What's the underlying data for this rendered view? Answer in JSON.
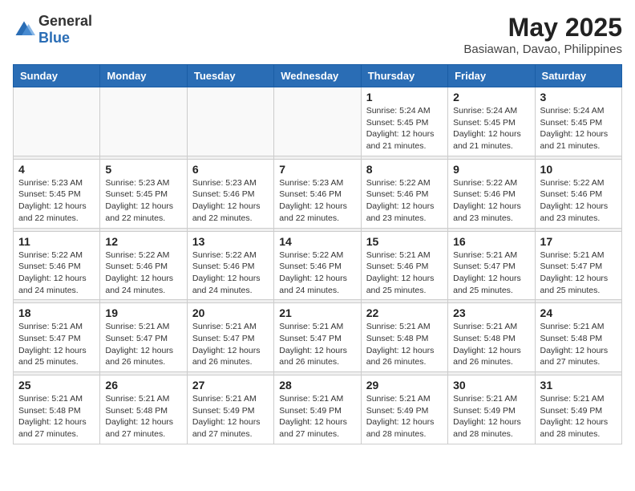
{
  "header": {
    "logo_general": "General",
    "logo_blue": "Blue",
    "title": "May 2025",
    "subtitle": "Basiawan, Davao, Philippines"
  },
  "weekdays": [
    "Sunday",
    "Monday",
    "Tuesday",
    "Wednesday",
    "Thursday",
    "Friday",
    "Saturday"
  ],
  "weeks": [
    [
      {
        "day": "",
        "info": ""
      },
      {
        "day": "",
        "info": ""
      },
      {
        "day": "",
        "info": ""
      },
      {
        "day": "",
        "info": ""
      },
      {
        "day": "1",
        "info": "Sunrise: 5:24 AM\nSunset: 5:45 PM\nDaylight: 12 hours\nand 21 minutes."
      },
      {
        "day": "2",
        "info": "Sunrise: 5:24 AM\nSunset: 5:45 PM\nDaylight: 12 hours\nand 21 minutes."
      },
      {
        "day": "3",
        "info": "Sunrise: 5:24 AM\nSunset: 5:45 PM\nDaylight: 12 hours\nand 21 minutes."
      }
    ],
    [
      {
        "day": "4",
        "info": "Sunrise: 5:23 AM\nSunset: 5:45 PM\nDaylight: 12 hours\nand 22 minutes."
      },
      {
        "day": "5",
        "info": "Sunrise: 5:23 AM\nSunset: 5:45 PM\nDaylight: 12 hours\nand 22 minutes."
      },
      {
        "day": "6",
        "info": "Sunrise: 5:23 AM\nSunset: 5:46 PM\nDaylight: 12 hours\nand 22 minutes."
      },
      {
        "day": "7",
        "info": "Sunrise: 5:23 AM\nSunset: 5:46 PM\nDaylight: 12 hours\nand 22 minutes."
      },
      {
        "day": "8",
        "info": "Sunrise: 5:22 AM\nSunset: 5:46 PM\nDaylight: 12 hours\nand 23 minutes."
      },
      {
        "day": "9",
        "info": "Sunrise: 5:22 AM\nSunset: 5:46 PM\nDaylight: 12 hours\nand 23 minutes."
      },
      {
        "day": "10",
        "info": "Sunrise: 5:22 AM\nSunset: 5:46 PM\nDaylight: 12 hours\nand 23 minutes."
      }
    ],
    [
      {
        "day": "11",
        "info": "Sunrise: 5:22 AM\nSunset: 5:46 PM\nDaylight: 12 hours\nand 24 minutes."
      },
      {
        "day": "12",
        "info": "Sunrise: 5:22 AM\nSunset: 5:46 PM\nDaylight: 12 hours\nand 24 minutes."
      },
      {
        "day": "13",
        "info": "Sunrise: 5:22 AM\nSunset: 5:46 PM\nDaylight: 12 hours\nand 24 minutes."
      },
      {
        "day": "14",
        "info": "Sunrise: 5:22 AM\nSunset: 5:46 PM\nDaylight: 12 hours\nand 24 minutes."
      },
      {
        "day": "15",
        "info": "Sunrise: 5:21 AM\nSunset: 5:46 PM\nDaylight: 12 hours\nand 25 minutes."
      },
      {
        "day": "16",
        "info": "Sunrise: 5:21 AM\nSunset: 5:47 PM\nDaylight: 12 hours\nand 25 minutes."
      },
      {
        "day": "17",
        "info": "Sunrise: 5:21 AM\nSunset: 5:47 PM\nDaylight: 12 hours\nand 25 minutes."
      }
    ],
    [
      {
        "day": "18",
        "info": "Sunrise: 5:21 AM\nSunset: 5:47 PM\nDaylight: 12 hours\nand 25 minutes."
      },
      {
        "day": "19",
        "info": "Sunrise: 5:21 AM\nSunset: 5:47 PM\nDaylight: 12 hours\nand 26 minutes."
      },
      {
        "day": "20",
        "info": "Sunrise: 5:21 AM\nSunset: 5:47 PM\nDaylight: 12 hours\nand 26 minutes."
      },
      {
        "day": "21",
        "info": "Sunrise: 5:21 AM\nSunset: 5:47 PM\nDaylight: 12 hours\nand 26 minutes."
      },
      {
        "day": "22",
        "info": "Sunrise: 5:21 AM\nSunset: 5:48 PM\nDaylight: 12 hours\nand 26 minutes."
      },
      {
        "day": "23",
        "info": "Sunrise: 5:21 AM\nSunset: 5:48 PM\nDaylight: 12 hours\nand 26 minutes."
      },
      {
        "day": "24",
        "info": "Sunrise: 5:21 AM\nSunset: 5:48 PM\nDaylight: 12 hours\nand 27 minutes."
      }
    ],
    [
      {
        "day": "25",
        "info": "Sunrise: 5:21 AM\nSunset: 5:48 PM\nDaylight: 12 hours\nand 27 minutes."
      },
      {
        "day": "26",
        "info": "Sunrise: 5:21 AM\nSunset: 5:48 PM\nDaylight: 12 hours\nand 27 minutes."
      },
      {
        "day": "27",
        "info": "Sunrise: 5:21 AM\nSunset: 5:49 PM\nDaylight: 12 hours\nand 27 minutes."
      },
      {
        "day": "28",
        "info": "Sunrise: 5:21 AM\nSunset: 5:49 PM\nDaylight: 12 hours\nand 27 minutes."
      },
      {
        "day": "29",
        "info": "Sunrise: 5:21 AM\nSunset: 5:49 PM\nDaylight: 12 hours\nand 28 minutes."
      },
      {
        "day": "30",
        "info": "Sunrise: 5:21 AM\nSunset: 5:49 PM\nDaylight: 12 hours\nand 28 minutes."
      },
      {
        "day": "31",
        "info": "Sunrise: 5:21 AM\nSunset: 5:49 PM\nDaylight: 12 hours\nand 28 minutes."
      }
    ]
  ]
}
